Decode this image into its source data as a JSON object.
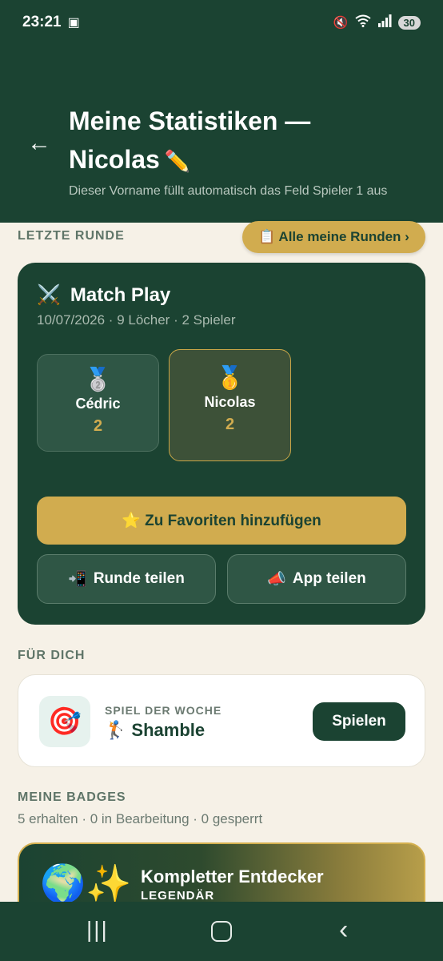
{
  "status_bar": {
    "time": "23:21",
    "notification_icon": "screen-record-icon",
    "right_icons": [
      "mute-vibrate-icon",
      "wifi-6-icon",
      "signal-icon"
    ],
    "battery": "30"
  },
  "header": {
    "back_glyph": "←",
    "title_line1": "Meine Statistiken —",
    "title_line2": "Nicolas",
    "edit_glyph": "✏️",
    "subtitle": "Dieser Vorname füllt automatisch das Feld Spieler 1 aus"
  },
  "last_round": {
    "section_label": "LETZTE RUNDE",
    "all_rounds_button": "📋 Alle meine Runden ›",
    "card": {
      "icon": "⚔️",
      "title": "Match Play",
      "meta": "10/07/2026 · 9 Löcher · 2 Spieler",
      "players": [
        {
          "medal": "🥈",
          "name": "Cédric",
          "score": "2"
        },
        {
          "medal": "🥇",
          "name": "Nicolas",
          "score": "2"
        }
      ],
      "favorite_button": "⭐ Zu Favoriten hinzufügen",
      "share_round_button": "Runde teilen",
      "share_round_icon": "📲",
      "share_app_button": "App teilen",
      "share_app_icon": "📣"
    }
  },
  "for_you": {
    "section_label": "FÜR DICH",
    "card": {
      "icon": "🎯",
      "kicker": "SPIEL DER WOCHE",
      "game_icon": "🏌️",
      "game_name": "Shamble",
      "play_button": "Spielen"
    }
  },
  "badges": {
    "section_label": "MEINE BADGES",
    "summary": "5 erhalten · 0 in Bearbeitung · 0 gesperrt",
    "first_badge": {
      "emoji": "🌍✨",
      "title": "Kompletter Entdecker",
      "rarity": "LEGENDÄR"
    }
  },
  "nav_bar": {
    "recents_glyph": "|||",
    "back_glyph": "‹"
  },
  "colors": {
    "primary_green": "#1b4332",
    "gold": "#d1ac4f",
    "background": "#f6f1e7"
  }
}
